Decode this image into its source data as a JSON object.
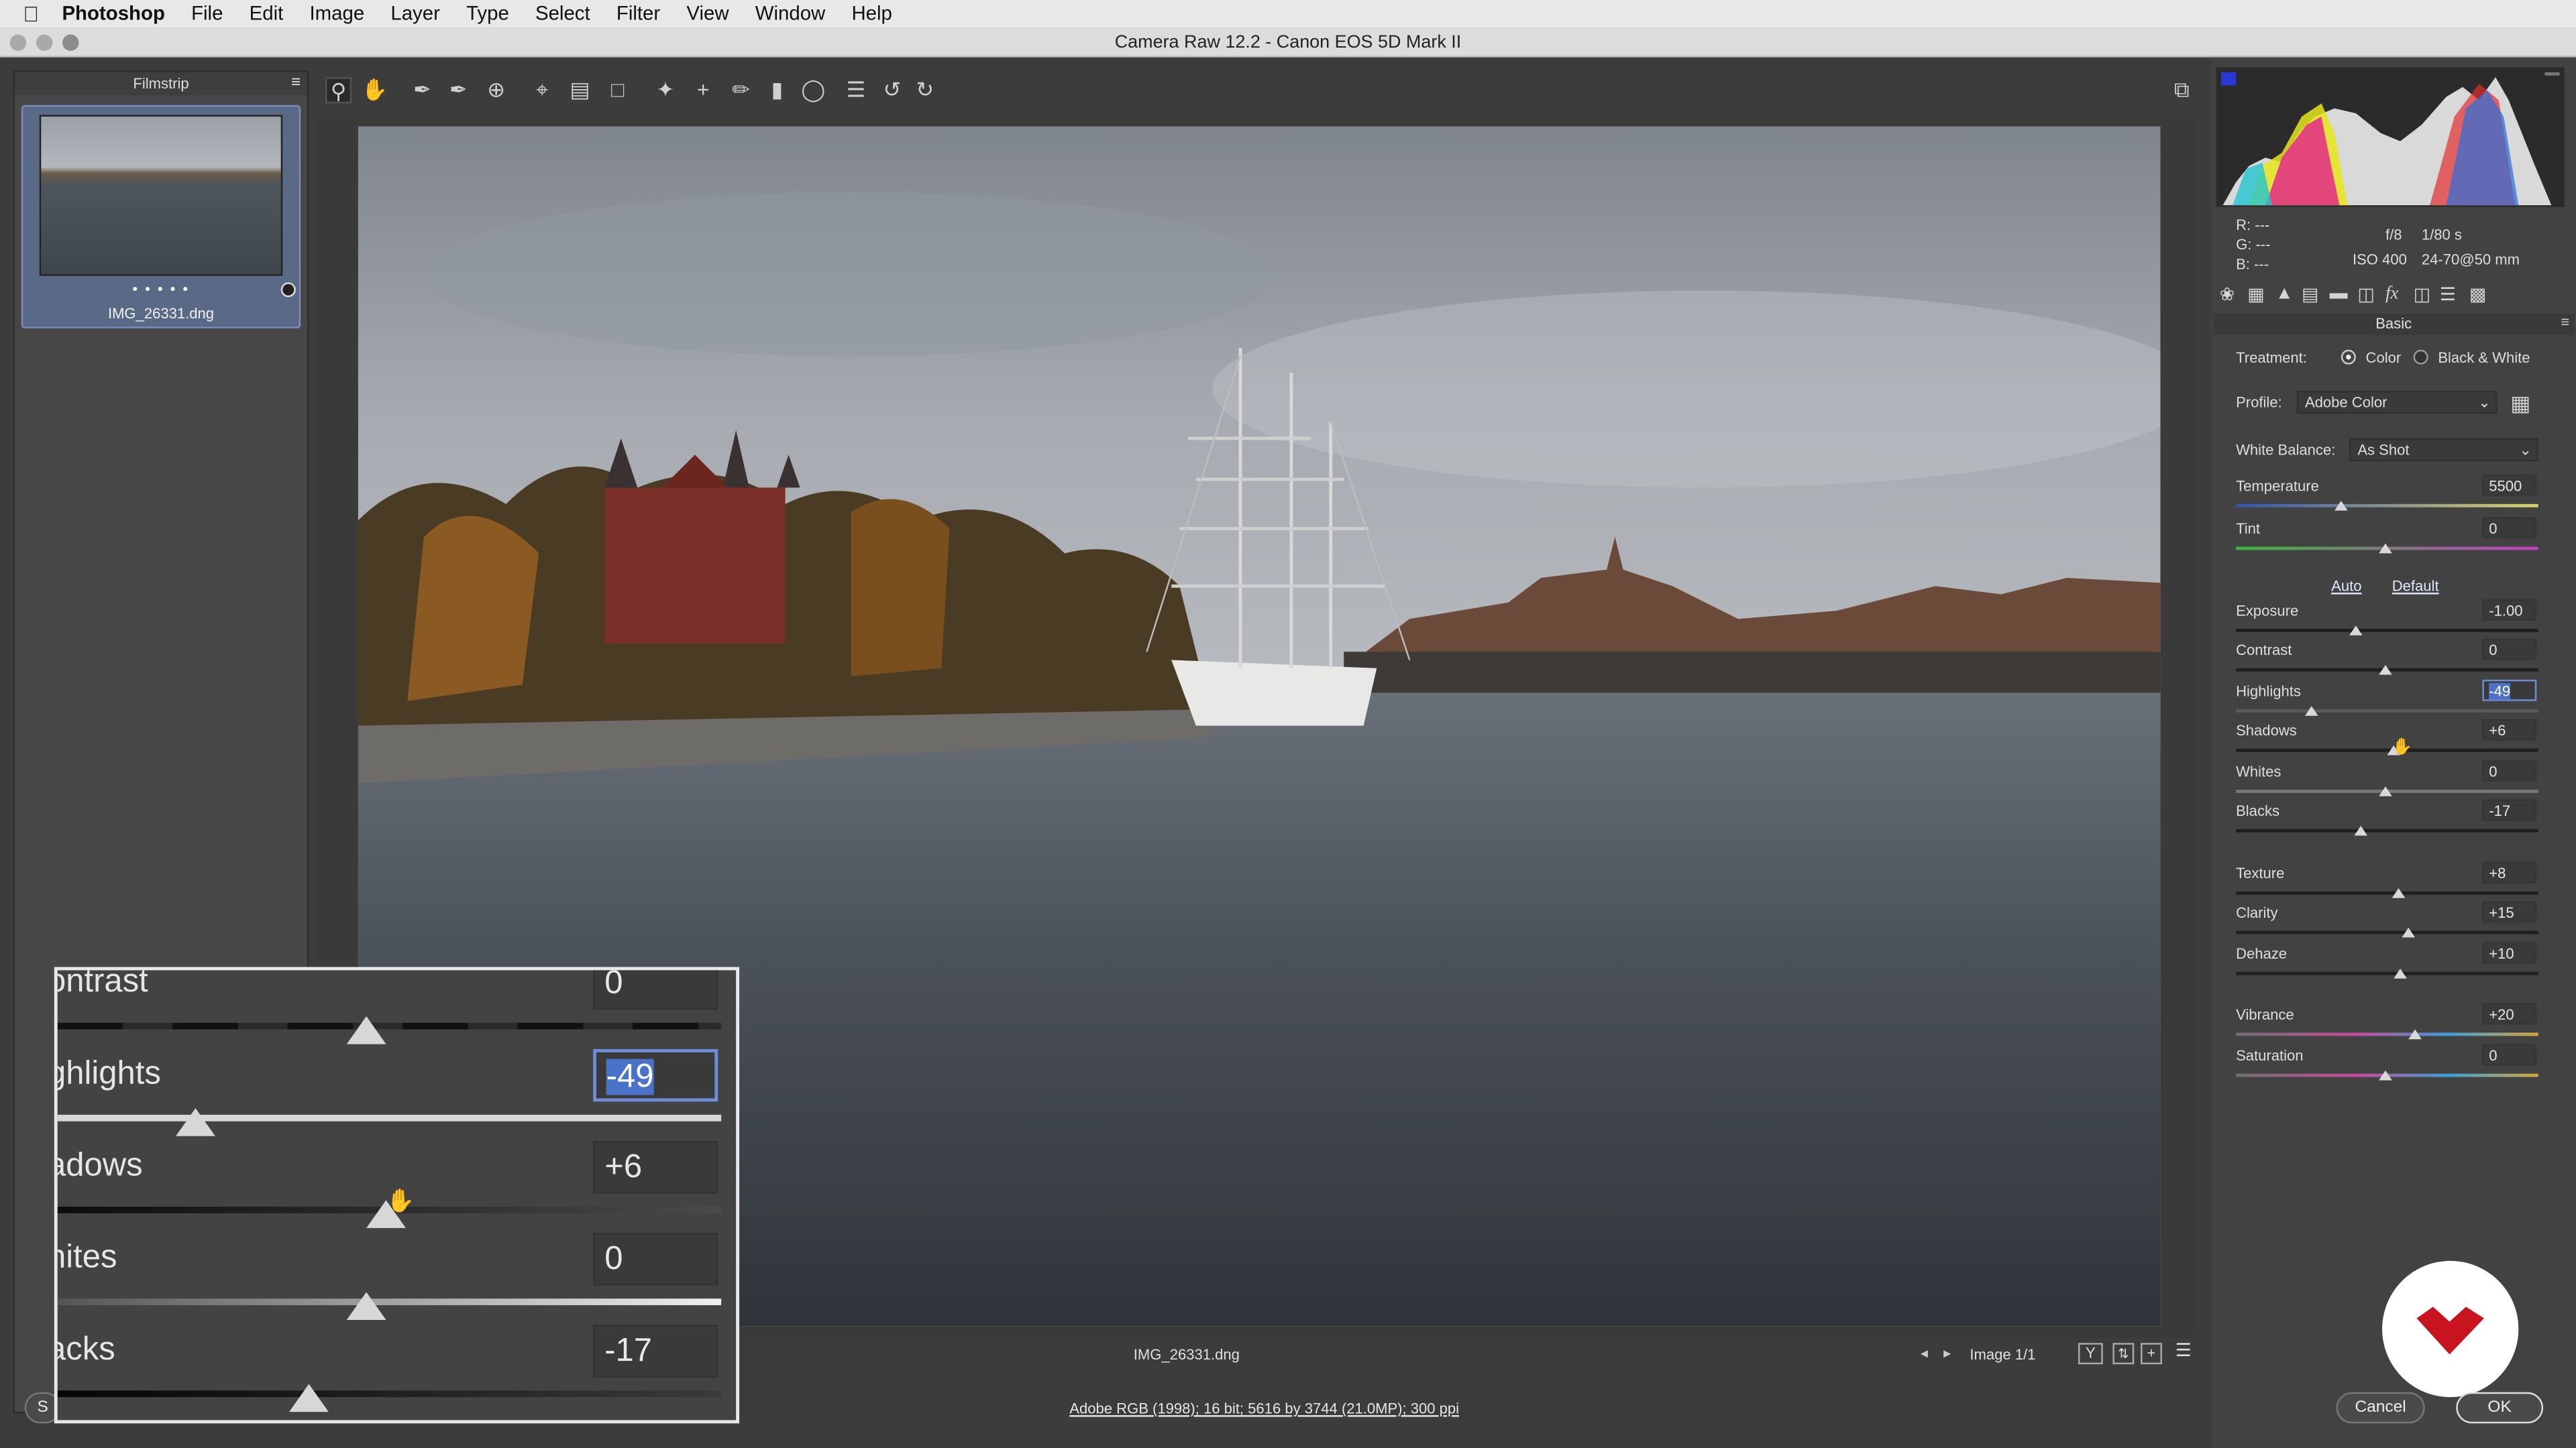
{
  "menubar": {
    "app": "Photoshop",
    "items": [
      "File",
      "Edit",
      "Image",
      "Layer",
      "Type",
      "Select",
      "Filter",
      "View",
      "Window",
      "Help"
    ]
  },
  "window": {
    "title": "Camera Raw 12.2  -  Canon EOS 5D Mark II"
  },
  "filmstrip": {
    "title": "Filmstrip",
    "thumbnail": {
      "filename": "IMG_26331.dng",
      "rating": "• • • • •"
    }
  },
  "toolbar": {
    "tools": [
      "zoom-icon",
      "hand-icon",
      "white-balance-icon",
      "color-sampler-icon",
      "targeted-adjustment-icon",
      "crop-icon",
      "straighten-icon",
      "transform-icon",
      "spot-removal-icon",
      "red-eye-icon",
      "adjustment-brush-icon",
      "graduated-filter-icon",
      "radial-filter-icon",
      "presets-list-icon",
      "rotate-ccw-icon",
      "rotate-cw-icon"
    ]
  },
  "preview": {
    "filename": "IMG_26331.dng",
    "image_counter": "Image 1/1",
    "workflow_options": "Adobe RGB (1998); 16 bit; 5616 by 3744 (21.0MP); 300 ppi"
  },
  "histogram": {
    "r": "R:  ---",
    "g": "G:  ---",
    "b": "B:  ---",
    "aperture": "f/8",
    "shutter": "1/80 s",
    "iso": "ISO 400",
    "lens": "24-70@50 mm"
  },
  "panel": {
    "title": "Basic",
    "treatment_label": "Treatment:",
    "treatment_color": "Color",
    "treatment_bw": "Black & White",
    "profile_label": "Profile:",
    "profile_value": "Adobe Color",
    "wb_label": "White Balance:",
    "wb_value": "As Shot",
    "auto": "Auto",
    "default": "Default",
    "sliders": {
      "temperature": {
        "label": "Temperature",
        "value": "5500"
      },
      "tint": {
        "label": "Tint",
        "value": "0"
      },
      "exposure": {
        "label": "Exposure",
        "value": "-1.00"
      },
      "contrast": {
        "label": "Contrast",
        "value": "0"
      },
      "highlights": {
        "label": "Highlights",
        "value": "-49"
      },
      "shadows": {
        "label": "Shadows",
        "value": "+6"
      },
      "whites": {
        "label": "Whites",
        "value": "0"
      },
      "blacks": {
        "label": "Blacks",
        "value": "-17"
      },
      "texture": {
        "label": "Texture",
        "value": "+8"
      },
      "clarity": {
        "label": "Clarity",
        "value": "+15"
      },
      "dehaze": {
        "label": "Dehaze",
        "value": "+10"
      },
      "vibrance": {
        "label": "Vibrance",
        "value": "+20"
      },
      "saturation": {
        "label": "Saturation",
        "value": "0"
      }
    }
  },
  "buttons": {
    "cancel": "Cancel",
    "ok": "OK",
    "save_fragment": "S"
  },
  "zoom_inset": {
    "contrast": {
      "label": "ontrast",
      "value": "0"
    },
    "highlights": {
      "label": "ghlights",
      "value": "-49"
    },
    "shadows": {
      "label": "adows",
      "value": "+6"
    },
    "whites": {
      "label": "hites",
      "value": "0"
    },
    "blacks": {
      "label": "acks",
      "value": "-17"
    }
  },
  "colors": {
    "accent": "#4a72c8",
    "logo_red": "#c8141e"
  }
}
